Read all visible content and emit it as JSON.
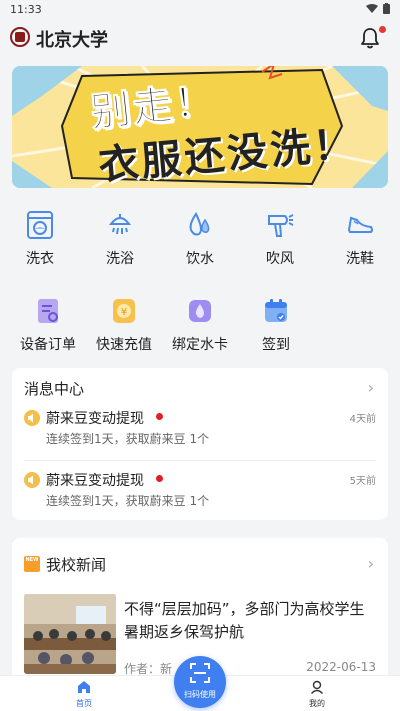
{
  "status": {
    "time": "11:33"
  },
  "header": {
    "title": "北京大学"
  },
  "banner": {
    "line1": "别走！",
    "line2": "衣服还没洗！"
  },
  "services_row1": [
    {
      "label": "洗衣",
      "icon": "washing-machine-icon"
    },
    {
      "label": "洗浴",
      "icon": "shower-icon"
    },
    {
      "label": "饮水",
      "icon": "water-drop-icon"
    },
    {
      "label": "吹风",
      "icon": "hair-dryer-icon"
    },
    {
      "label": "洗鞋",
      "icon": "shoe-icon"
    }
  ],
  "services_row2": [
    {
      "label": "设备订单",
      "icon": "order-icon"
    },
    {
      "label": "快速充值",
      "icon": "recharge-icon"
    },
    {
      "label": "绑定水卡",
      "icon": "water-card-icon"
    },
    {
      "label": "签到",
      "icon": "checkin-calendar-icon"
    }
  ],
  "messages": {
    "title": "消息中心",
    "items": [
      {
        "title": "蔚来豆变动提现",
        "subtitle": "连续签到1天，获取蔚来豆 1个",
        "ago": "4天前"
      },
      {
        "title": "蔚来豆变动提现",
        "subtitle": "连续签到1天，获取蔚来豆 1个",
        "ago": "5天前"
      }
    ]
  },
  "news": {
    "title": "我校新闻",
    "badge": "NEW",
    "item": {
      "headline": "不得“层层加码”，多部门为高校学生暑期返乡保驾护航",
      "author": "作者：新",
      "date": "2022-06-13"
    }
  },
  "tabbar": {
    "home": "首页",
    "scan": "扫码使用",
    "mine": "我的"
  },
  "colors": {
    "accent": "#3f7ff0",
    "icon": "#4a8be6",
    "badge": "#e53935"
  }
}
